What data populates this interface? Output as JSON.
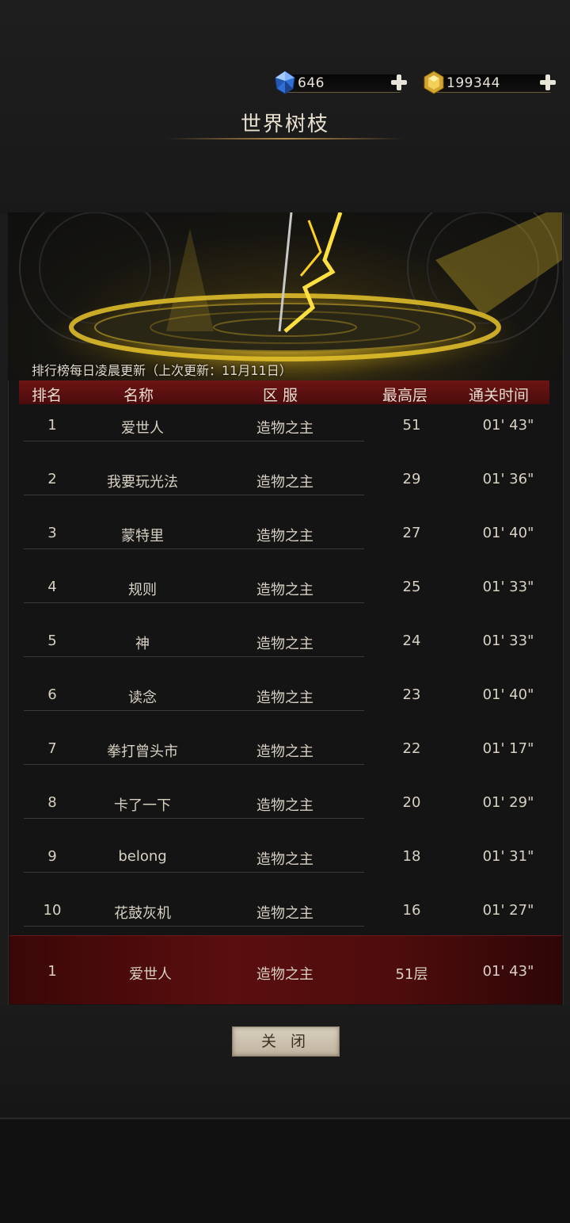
{
  "currency": {
    "diamond": "646",
    "gold": "199344"
  },
  "title": "世界树枝",
  "notice": "排行榜每日凌晨更新（上次更新：11月11日）",
  "columns": [
    "排名",
    "名称",
    "区 服",
    "最高层",
    "通关时间"
  ],
  "rows": [
    {
      "rank": "1",
      "name": "爱世人",
      "server": "造物之主",
      "floor": "51",
      "time": "01' 43\""
    },
    {
      "rank": "2",
      "name": "我要玩光法",
      "server": "造物之主",
      "floor": "29",
      "time": "01' 36\""
    },
    {
      "rank": "3",
      "name": "蒙特里",
      "server": "造物之主",
      "floor": "27",
      "time": "01' 40\""
    },
    {
      "rank": "4",
      "name": "规则",
      "server": "造物之主",
      "floor": "25",
      "time": "01' 33\""
    },
    {
      "rank": "5",
      "name": "神",
      "server": "造物之主",
      "floor": "24",
      "time": "01' 33\""
    },
    {
      "rank": "6",
      "name": "读念",
      "server": "造物之主",
      "floor": "23",
      "time": "01' 40\""
    },
    {
      "rank": "7",
      "name": "拳打曾头市",
      "server": "造物之主",
      "floor": "22",
      "time": "01' 17\""
    },
    {
      "rank": "8",
      "name": "卡了一下",
      "server": "造物之主",
      "floor": "20",
      "time": "01' 29\""
    },
    {
      "rank": "9",
      "name": "belong",
      "server": "造物之主",
      "floor": "18",
      "time": "01' 31\""
    },
    {
      "rank": "10",
      "name": "花鼓灰机",
      "server": "造物之主",
      "floor": "16",
      "time": "01' 27\""
    }
  ],
  "my_rank": {
    "rank": "1",
    "name": "爱世人",
    "server": "造物之主",
    "floor": "51层",
    "time": "01' 43\""
  },
  "close_label": "关 闭",
  "icons": {
    "diamond": "blue-gem-icon",
    "gold": "gold-gem-icon",
    "add": "plus-icon"
  },
  "colors": {
    "header_red": "#6e1414",
    "highlight_row": "#5a0e0e",
    "gold": "#d4a530"
  }
}
